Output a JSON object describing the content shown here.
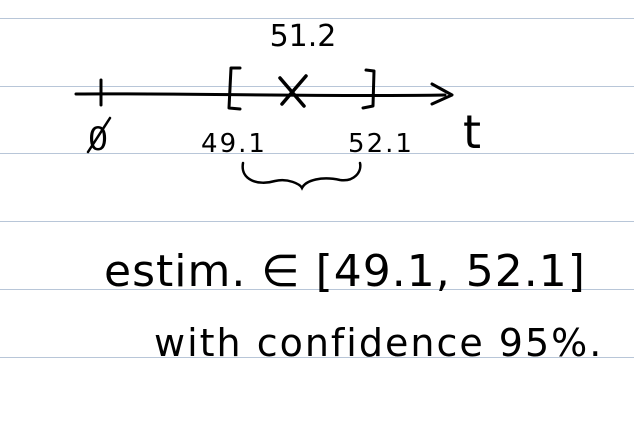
{
  "note": {
    "estimate_label": "51.2",
    "origin_label": "0",
    "lower_label": "49.1",
    "upper_label": "52.1",
    "axis_label": "t",
    "statement_line1": "estim. ∈ [49.1, 52.1]",
    "statement_line2": "with confidence 95%."
  },
  "colors": {
    "ink": "#000000",
    "ruled_line": "#b8c6d8",
    "paper": "#ffffff"
  }
}
